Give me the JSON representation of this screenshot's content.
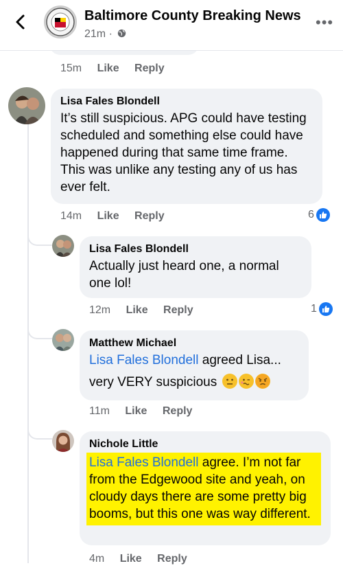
{
  "header": {
    "page_name": "Baltimore County Breaking News",
    "time": "21m ·",
    "back_icon": "chevron-left-icon",
    "more_icon": "more-dots-icon",
    "privacy_icon": "globe-icon"
  },
  "top_actions": {
    "time": "15m",
    "like": "Like",
    "reply": "Reply"
  },
  "comments": [
    {
      "author": "Lisa Fales Blondell",
      "text": "It’s still suspicious. APG could have testing scheduled and something else could have happened during that same time frame. This was unlike any testing any of us has ever felt.",
      "time": "14m",
      "like": "Like",
      "reply": "Reply",
      "reactions": "6"
    },
    {
      "author": "Lisa Fales Blondell",
      "text": "Actually just heard one, a normal one lol!",
      "time": "12m",
      "like": "Like",
      "reply": "Reply",
      "reactions": "1"
    },
    {
      "author": "Matthew Michael",
      "mention": "Lisa Fales Blondell",
      "text_after_mention": " agreed Lisa...",
      "text_line2": "very VERY suspicious",
      "emojis": [
        "neutral-face-emoji",
        "woozy-face-emoji",
        "angry-face-emoji"
      ],
      "time": "11m",
      "like": "Like",
      "reply": "Reply"
    },
    {
      "author": "Nichole Little",
      "mention": "Lisa Fales Blondell",
      "text_after_mention": " agree. I’m not far from the Edgewood site and yeah, on cloudy days there are some pretty big booms, but this one was way different.",
      "time": "4m",
      "like": "Like",
      "reply": "Reply",
      "highlight_color": "#fff200"
    }
  ],
  "colors": {
    "mention": "#216fdb",
    "bubble": "#f0f2f5",
    "like_blue": "#1877f2",
    "muted": "#65676b"
  }
}
